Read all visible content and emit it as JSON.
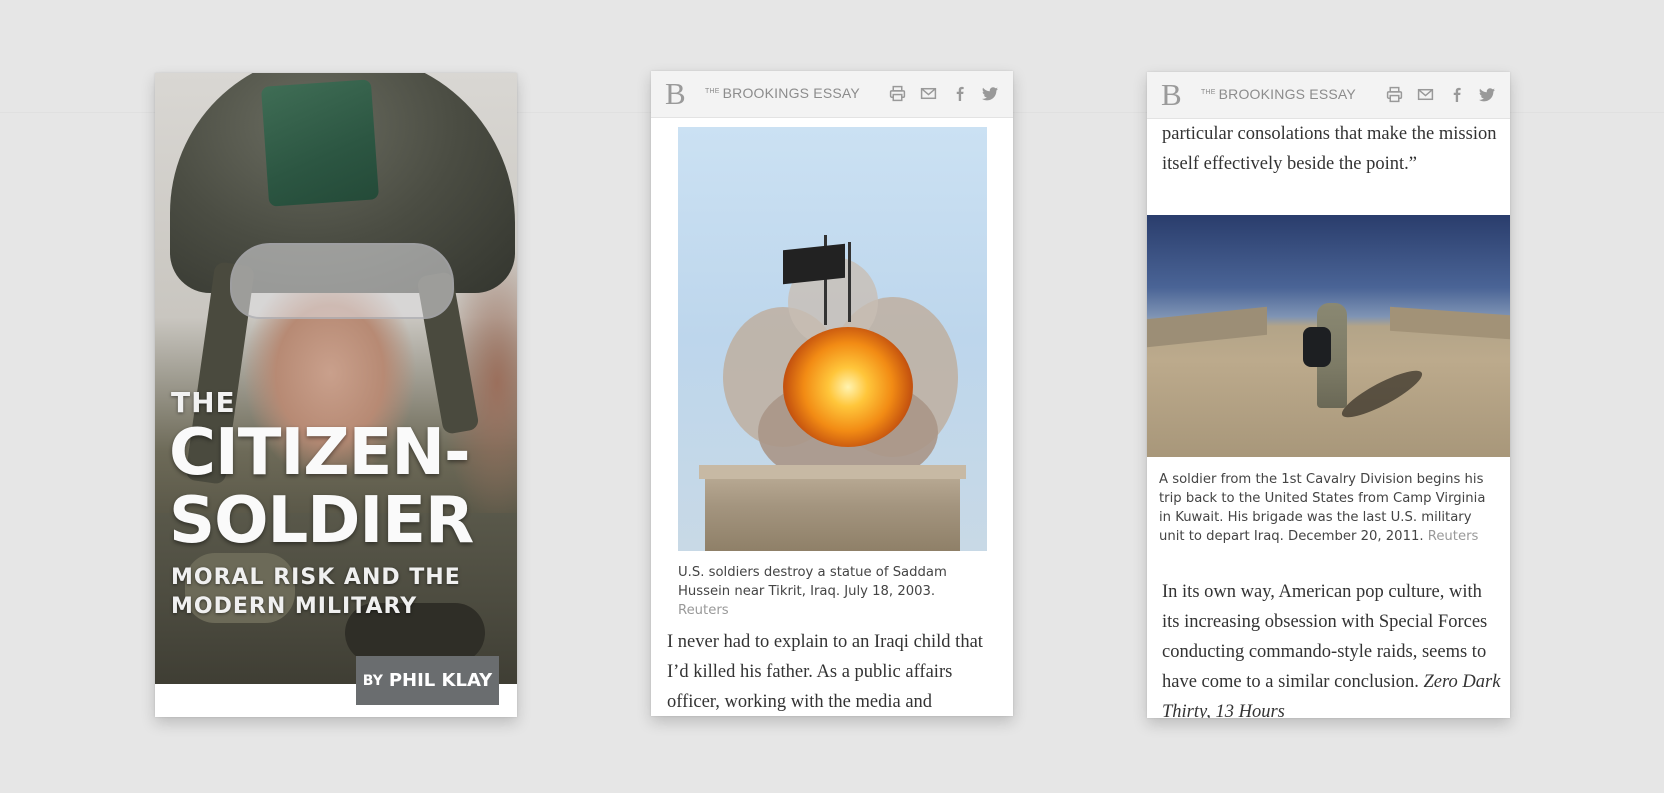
{
  "cover": {
    "the": "THE",
    "title_line1": "CITIZEN-",
    "title_line2": "SOLDIER",
    "subtitle": "MORAL RISK AND THE MODERN MILITARY",
    "byline_prefix": "BY",
    "byline_name": "PHIL KLAY"
  },
  "header": {
    "logo": "B",
    "brand_small": "THE",
    "brand": "BROOKINGS ESSAY",
    "icons": [
      "print-icon",
      "email-icon",
      "facebook-icon",
      "twitter-icon"
    ]
  },
  "screen2": {
    "caption": "U.S. soldiers destroy a statue of Saddam Hussein near Tikrit, Iraq. July 18, 2003.",
    "credit": "Reuters",
    "body": "I never had to explain to an Iraqi child that I’d killed his father. As a public affairs officer, working with the media and"
  },
  "screen3": {
    "body_top": "particular consolations that make the mission itself effectively beside the point.”",
    "caption": "A soldier from the 1st Cavalry Division begins his trip back to the United States from Camp Virginia in Kuwait. His brigade was the last U.S. military unit to depart Iraq. December 20, 2011.",
    "credit": "Reuters",
    "body": "In its own way, American pop culture, with its increasing obsession with Special Forces conducting commando-style raids, seems to have come to a similar conclusion.",
    "body_italic": "Zero Dark Thirty, 13 Hours"
  },
  "colors": {
    "background": "#e6e6e6",
    "header": "#f3f3f3",
    "byline_box": "#6a6d6f",
    "credit_text": "#999999"
  }
}
